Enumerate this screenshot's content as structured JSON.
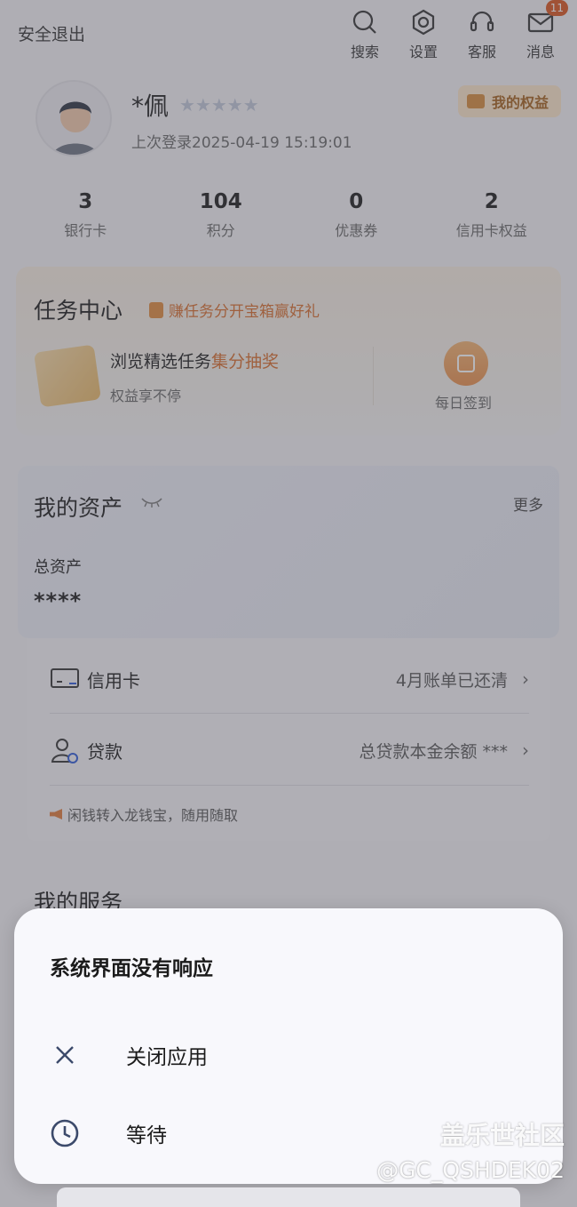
{
  "header": {
    "logout_label": "安全退出",
    "actions": [
      {
        "label": "搜索",
        "icon": "search-icon"
      },
      {
        "label": "设置",
        "icon": "gear-icon"
      },
      {
        "label": "客服",
        "icon": "headset-icon"
      },
      {
        "label": "消息",
        "icon": "mail-icon",
        "badge": "11"
      }
    ]
  },
  "profile": {
    "name": "*佩",
    "stars": "★★★★★",
    "last_login": "上次登录2025-04-19 15:19:01",
    "rights_button": "我的权益"
  },
  "stats": [
    {
      "value": "3",
      "label": "银行卡"
    },
    {
      "value": "104",
      "label": "积分"
    },
    {
      "value": "0",
      "label": "优惠券"
    },
    {
      "value": "2",
      "label": "信用卡权益"
    }
  ],
  "task_center": {
    "title": "任务中心",
    "promo": "赚任务分开宝箱赢好礼",
    "line1_prefix": "浏览精选任务",
    "line1_highlight": "集分抽奖",
    "line2": "权益享不停",
    "checkin_label": "每日签到"
  },
  "assets": {
    "title": "我的资产",
    "more": "更多",
    "total_label": "总资产",
    "total_value": "****",
    "credit_card": {
      "label": "信用卡",
      "info": "4月账单已还清",
      "chevron": "›"
    },
    "loan": {
      "label": "贷款",
      "info": "总贷款本金余额 ***",
      "chevron": "›"
    },
    "tip": "闲钱转入龙钱宝，随用随取"
  },
  "services": {
    "title": "我的服务"
  },
  "dialog": {
    "title": "系统界面没有响应",
    "options": [
      {
        "label": "关闭应用",
        "icon": "close-icon"
      },
      {
        "label": "等待",
        "icon": "clock-icon"
      }
    ]
  },
  "watermark": {
    "site": "盖乐世社区",
    "user": "@GC_QSHDEK02"
  },
  "colors": {
    "accent": "#d86c2a",
    "dialog_bg": "#f8f8fc",
    "icon": "#3c4a6b"
  }
}
